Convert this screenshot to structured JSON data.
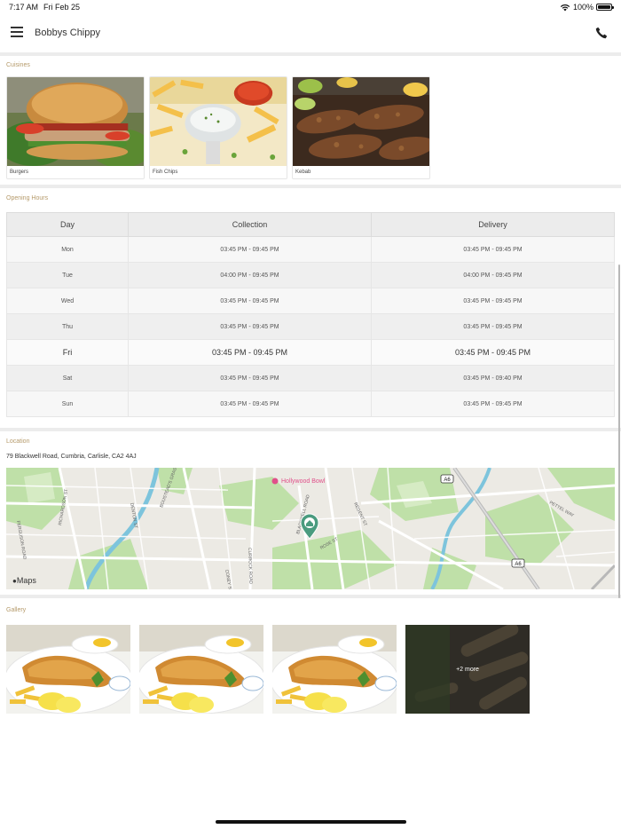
{
  "status_bar": {
    "time": "7:17 AM",
    "date": "Fri Feb 25",
    "battery": "100%",
    "battery_level": 1.0
  },
  "header": {
    "title": "Bobbys Chippy",
    "menu_icon": "hamburger-icon",
    "phone_icon": "phone-icon"
  },
  "cuisines": {
    "label": "Cuisines",
    "items": [
      {
        "name": "Burgers"
      },
      {
        "name": "Fish  Chips"
      },
      {
        "name": "Kebab"
      }
    ]
  },
  "opening_hours": {
    "label": "Opening Hours",
    "columns": [
      "Day",
      "Collection",
      "Delivery"
    ],
    "rows": [
      {
        "day": "Mon",
        "collection": "03:45 PM - 09:45 PM",
        "delivery": "03:45 PM - 09:45 PM"
      },
      {
        "day": "Tue",
        "collection": "04:00 PM - 09:45 PM",
        "delivery": "04:00 PM - 09:45 PM"
      },
      {
        "day": "Wed",
        "collection": "03:45 PM - 09:45 PM",
        "delivery": "03:45 PM - 09:45 PM"
      },
      {
        "day": "Thu",
        "collection": "03:45 PM - 09:45 PM",
        "delivery": "03:45 PM - 09:45 PM"
      },
      {
        "day": "Fri",
        "collection": "03:45 PM - 09:45 PM",
        "delivery": "03:45 PM - 09:45 PM"
      },
      {
        "day": "Sat",
        "collection": "03:45 PM - 09:45 PM",
        "delivery": "03:45 PM - 09:40 PM"
      },
      {
        "day": "Sun",
        "collection": "03:45 PM - 09:45 PM",
        "delivery": "03:45 PM - 09:45 PM"
      }
    ],
    "today": "Fri"
  },
  "location": {
    "label": "Location",
    "address": "79 Blackwell Road, Cumbria, Carlisle, CA2 4AJ",
    "map_brand": "Maps",
    "map_labels": {
      "poi": "Hollywood Bowl",
      "road_a6_1": "A6",
      "road_a6_2": "A6",
      "street_1": "BLACKWELL ROAD",
      "street_2": "ROSE ST",
      "street_3": "REGENT ST",
      "street_4": "CURROCK ROAD",
      "street_5": "DENTON ST",
      "street_6": "RICHARDSON ST",
      "street_7": "BOUSTEAD'S GRASSING",
      "street_8": "CONEY ST",
      "street_9": "FERGUSON ROAD",
      "street_10": "PETTEL WAY"
    }
  },
  "gallery": {
    "label": "Gallery",
    "more_label": "+2 more"
  },
  "colors": {
    "section_label": "#b59a6a",
    "map_pin": "#4a9b7f",
    "map_poi": "#e0508a"
  }
}
